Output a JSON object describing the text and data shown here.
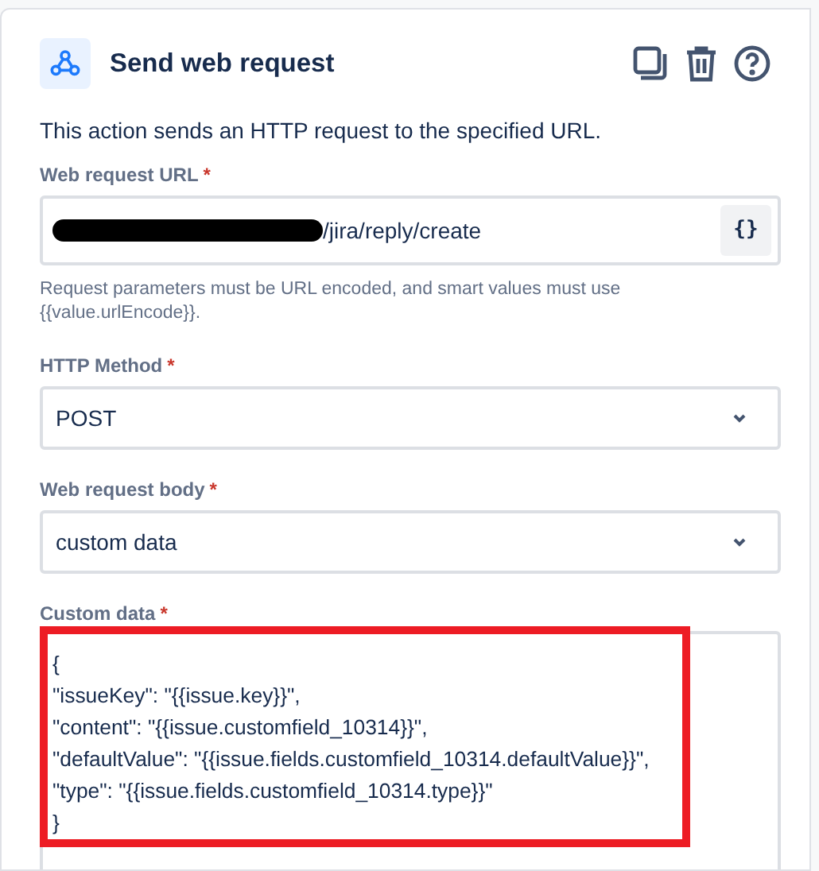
{
  "header": {
    "title": "Send web request",
    "actions": [
      {
        "kind": "copy"
      },
      {
        "kind": "delete"
      },
      {
        "kind": "help"
      }
    ]
  },
  "description": "This action sends an HTTP request to the specified URL.",
  "fields": [
    {
      "kind": "url",
      "label": "Web request URL",
      "required_mark": "*",
      "redacted": true,
      "value": "/jira/reply/create",
      "button": "{}",
      "help": "Request parameters must be URL encoded, and smart values must use {{value.urlEncode}}."
    },
    {
      "kind": "select",
      "label": "HTTP Method",
      "required_mark": "*",
      "value": "POST"
    },
    {
      "kind": "select",
      "label": "Web request body",
      "required_mark": "*",
      "value": "custom data"
    },
    {
      "kind": "code",
      "label": "Custom data",
      "required_mark": "*",
      "highlighted": true,
      "lines": [
        "{",
        "\"issueKey\": \"{{issue.key}}\",",
        "\"content\": \"{{issue.customfield_10314}}\",",
        "\"defaultValue\": \"{{issue.fields.customfield_10314.defaultValue}}\",",
        "\"type\": \"{{issue.fields.customfield_10314.type}}\"",
        "}"
      ]
    }
  ]
}
